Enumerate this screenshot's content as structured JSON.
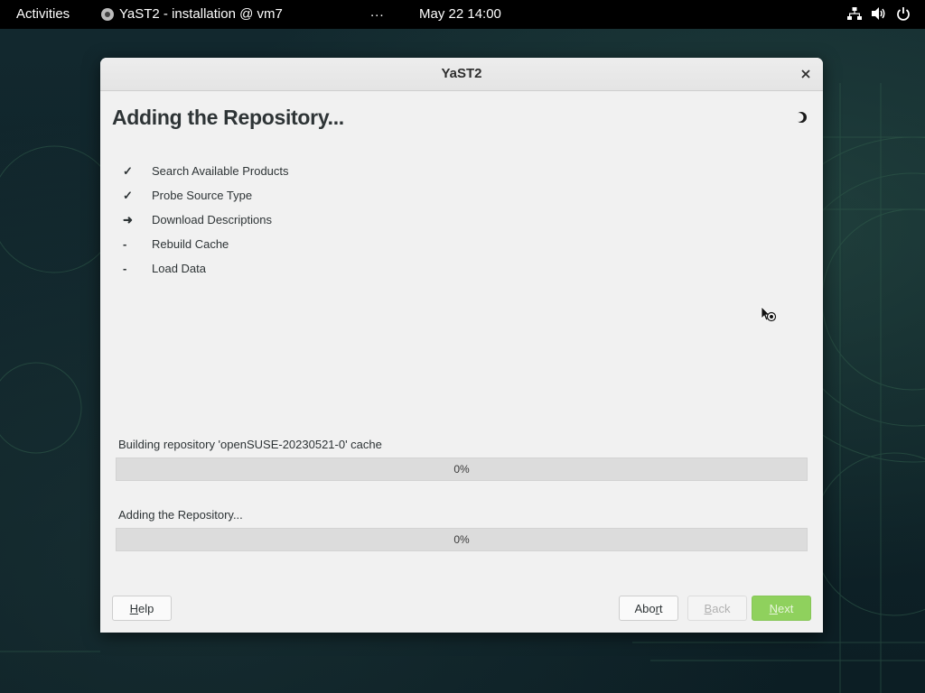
{
  "topbar": {
    "activities": "Activities",
    "app_title": "YaST2 - installation @ vm7",
    "overflow": "...",
    "clock": "May 22  14:00",
    "tray_icons": [
      "network-icon",
      "volume-icon",
      "power-icon"
    ]
  },
  "window": {
    "title": "YaST2",
    "heading": "Adding the Repository...",
    "steps": [
      {
        "status": "done",
        "mark": "✓",
        "label": "Search Available Products"
      },
      {
        "status": "done",
        "mark": "✓",
        "label": "Probe Source Type"
      },
      {
        "status": "current",
        "mark": "➜",
        "label": "Download Descriptions"
      },
      {
        "status": "pending",
        "mark": "-",
        "label": "Rebuild Cache"
      },
      {
        "status": "pending",
        "mark": "-",
        "label": "Load Data"
      }
    ],
    "progress": [
      {
        "label": "Building repository 'openSUSE-20230521-0' cache",
        "value": 0,
        "text": "0%"
      },
      {
        "label": "Adding the Repository...",
        "value": 0,
        "text": "0%"
      }
    ],
    "buttons": {
      "help": {
        "mnemonic": "H",
        "rest": "elp",
        "enabled": true
      },
      "abort": {
        "pre": "Abo",
        "mnemonic": "r",
        "rest": "t",
        "enabled": true
      },
      "back": {
        "mnemonic": "B",
        "rest": "ack",
        "enabled": false
      },
      "next": {
        "mnemonic": "N",
        "rest": "ext",
        "enabled": false
      }
    }
  },
  "colors": {
    "accent": "#73ba25",
    "next_button": "#8fd15d",
    "topbar": "#000000",
    "window_bg": "#f1f1f1"
  }
}
